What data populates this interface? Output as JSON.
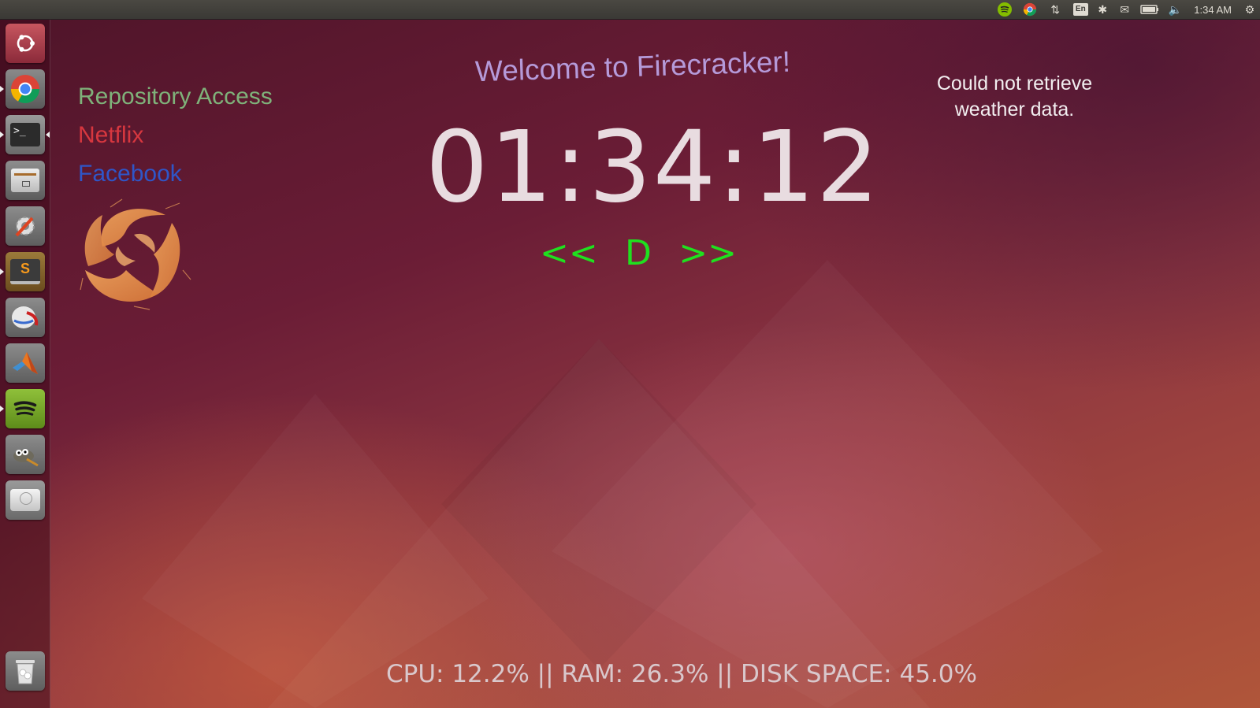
{
  "top_panel": {
    "clock": "1:34 AM",
    "language": "En",
    "tray_icons": [
      "spotify-icon",
      "chrome-icon",
      "network-icon",
      "keyboard-language-icon",
      "bluetooth-icon",
      "mail-icon",
      "battery-icon",
      "volume-icon",
      "session-gear-icon"
    ]
  },
  "launcher": {
    "apps": [
      "Ubuntu Dash",
      "Chrome",
      "Terminal",
      "Files",
      "System Settings",
      "Sublime Text",
      "Disk Utility",
      "MATLAB",
      "Spotify",
      "GIMP",
      "Disks",
      "Trash"
    ]
  },
  "links": {
    "repository": "Repository Access",
    "netflix": "Netflix",
    "facebook": "Facebook"
  },
  "colors": {
    "repository": "#7fb27a",
    "netflix": "#d7373f",
    "facebook": "#2f56c8",
    "nav": "#1fe01f",
    "welcome": "#b59ad9"
  },
  "welcome": "Welcome to Firecracker!",
  "clock": "01:34:12",
  "nav": {
    "prev": "<<",
    "mode": "D",
    "next": ">>"
  },
  "weather": {
    "line1": "Could not retrieve",
    "line2": "weather data."
  },
  "stats": "CPU: 12.2% || RAM: 26.3% || DISK SPACE: 45.0%"
}
